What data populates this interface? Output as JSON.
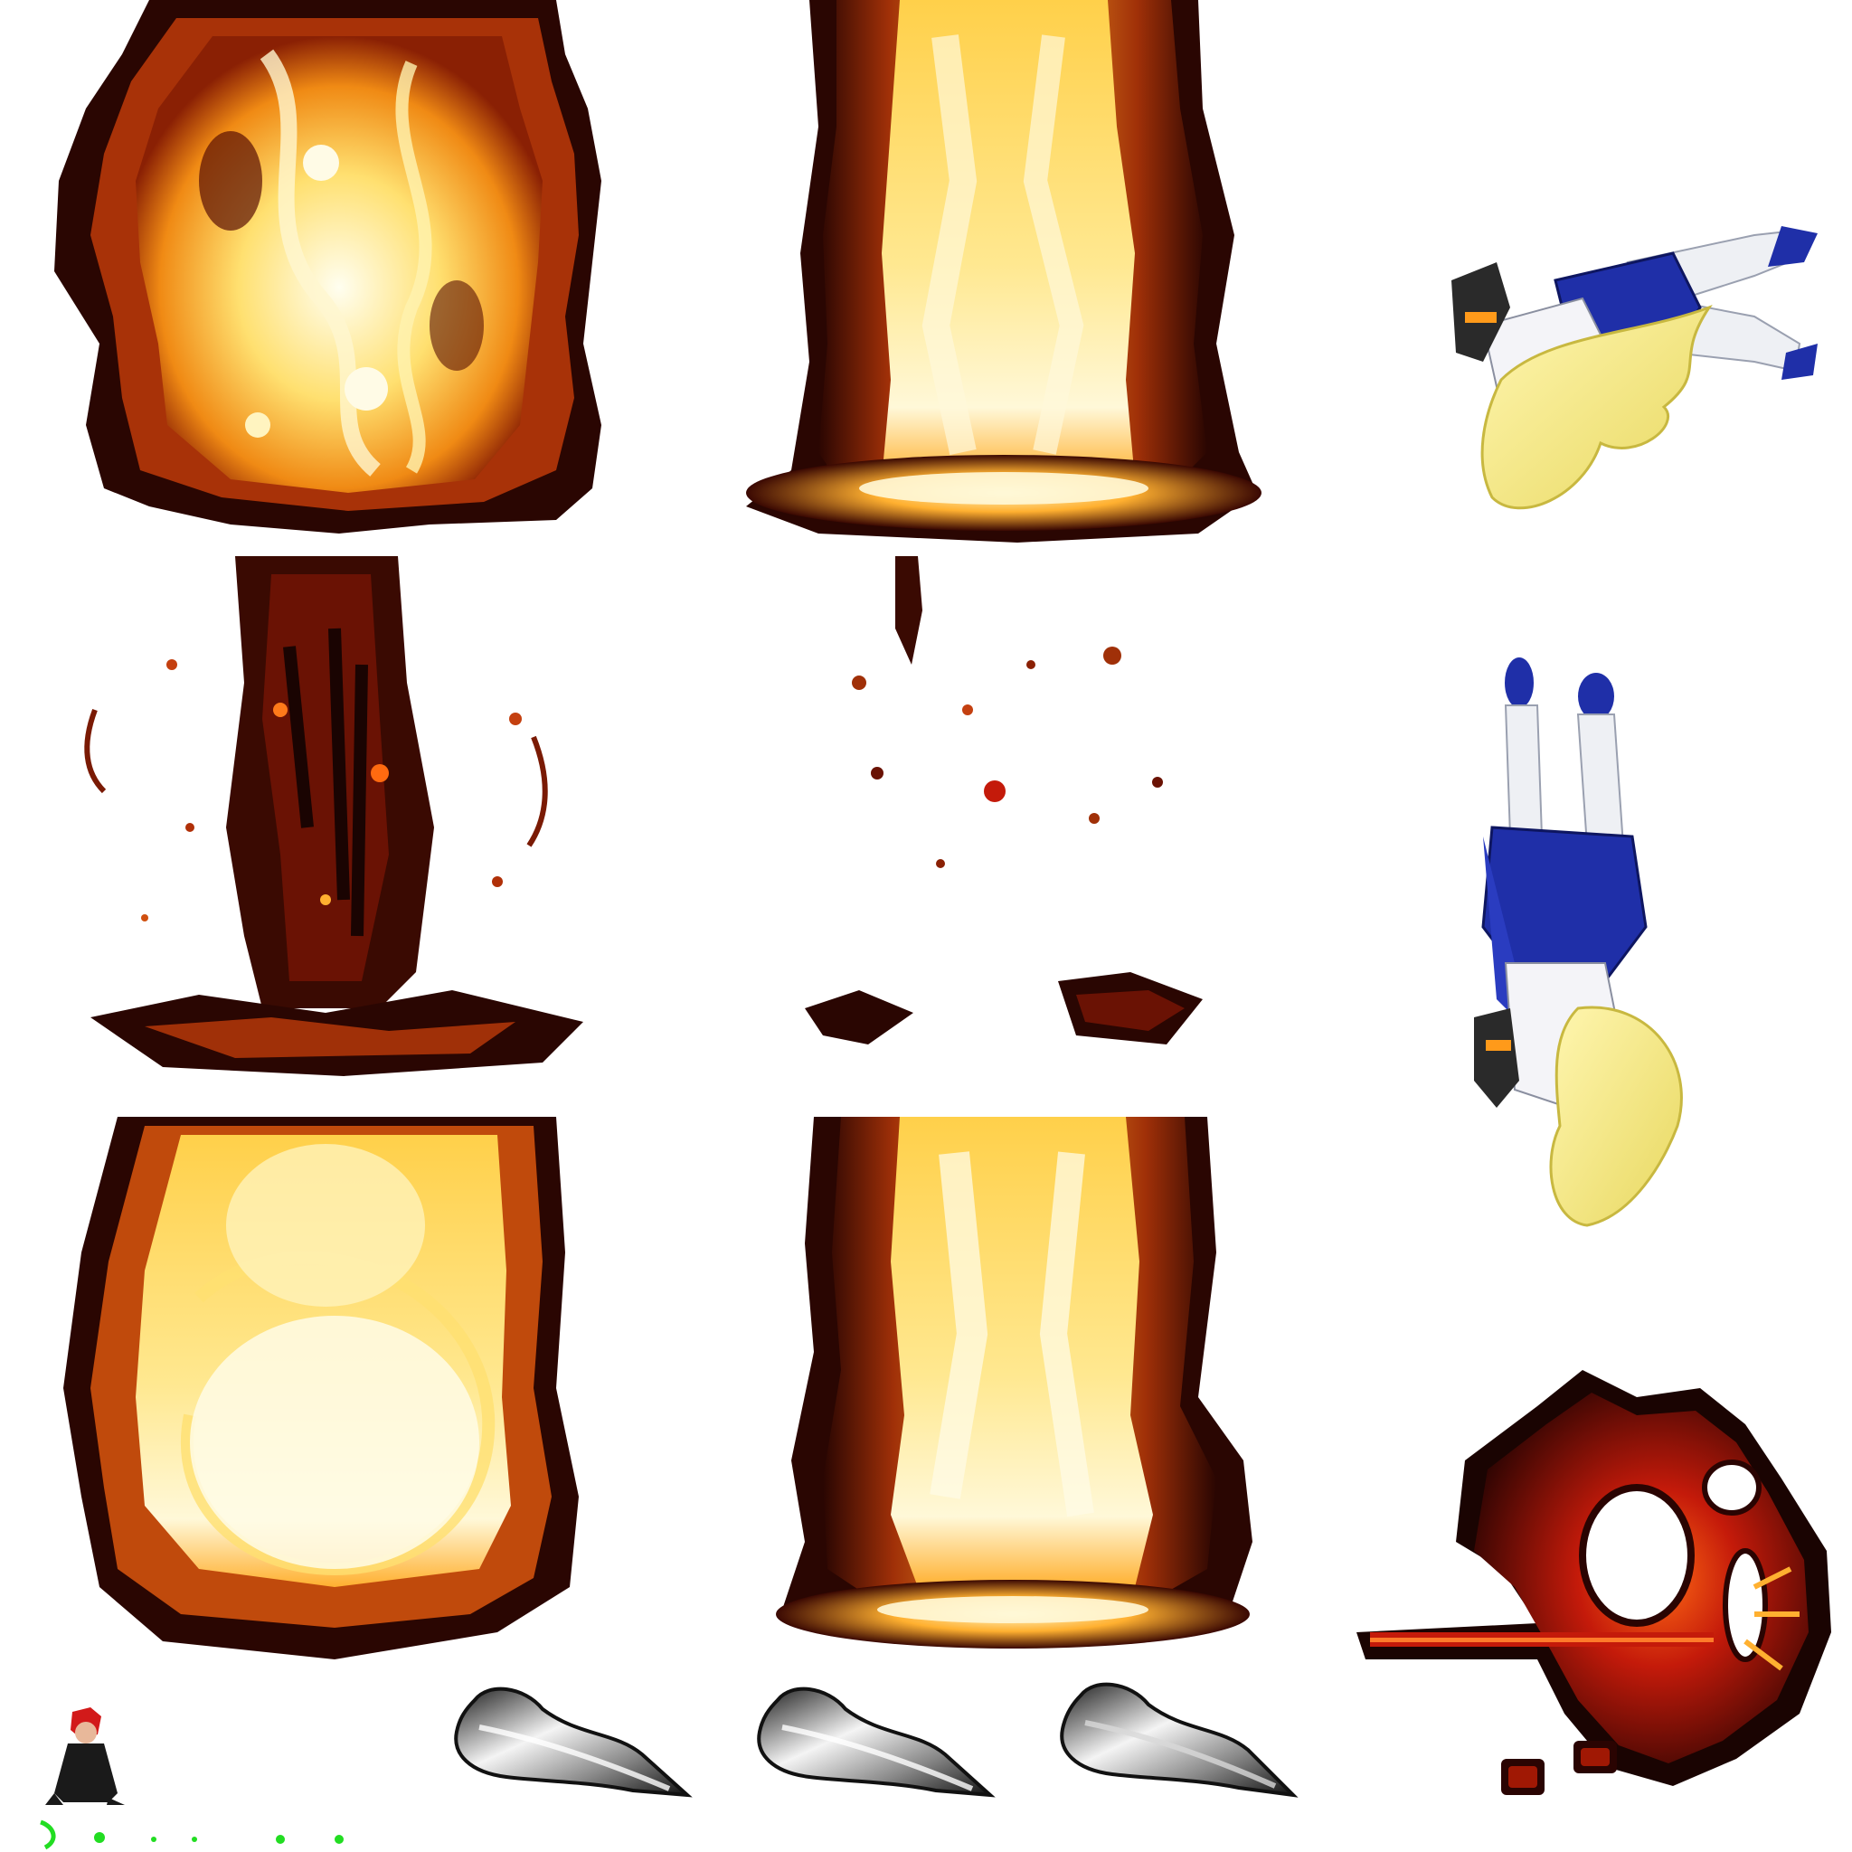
{
  "sheet": {
    "background": "#ffffff"
  },
  "colors": {
    "flame_core": "#fffbe6",
    "flame_mid": "#ffc02a",
    "flame_outer": "#e0600a",
    "ember_dark": "#3a0a02",
    "char_dark": "#1a0402",
    "lava_red": "#c41a0a",
    "hair_blonde": "#f6ec82",
    "uniform_blue": "#1f2fa8",
    "sock_white": "#eef0f4",
    "glove_dark": "#2a2a2a",
    "smear_grey": "#b8b8b8",
    "hitspark_green": "#22dd22"
  },
  "sprites": [
    {
      "name": "fire-pillar-sprite",
      "icon": "flame-column-icon"
    },
    {
      "name": "fire-pillar-sprite",
      "icon": "flame-column-icon"
    },
    {
      "name": "falling-character-sprite",
      "icon": "schoolgirl-falling-icon"
    },
    {
      "name": "dissipating-embers-sprite",
      "icon": "ember-scatter-icon"
    },
    {
      "name": "dissipating-embers-sprite",
      "icon": "ember-scatter-icon"
    },
    {
      "name": "falling-character-sprite",
      "icon": "schoolgirl-upside-down-icon"
    },
    {
      "name": "fire-pillar-sprite",
      "icon": "flame-column-icon"
    },
    {
      "name": "fire-pillar-sprite",
      "icon": "flame-column-icon"
    },
    {
      "name": "lava-explosion-sprite",
      "icon": "lava-burst-icon"
    },
    {
      "name": "mini-character-sprite",
      "icon": "red-haired-fighter-icon"
    },
    {
      "name": "motion-smear-sprite",
      "icon": "slash-smear-icon"
    },
    {
      "name": "hitspark-sprite",
      "icon": "green-spark-icon"
    }
  ]
}
